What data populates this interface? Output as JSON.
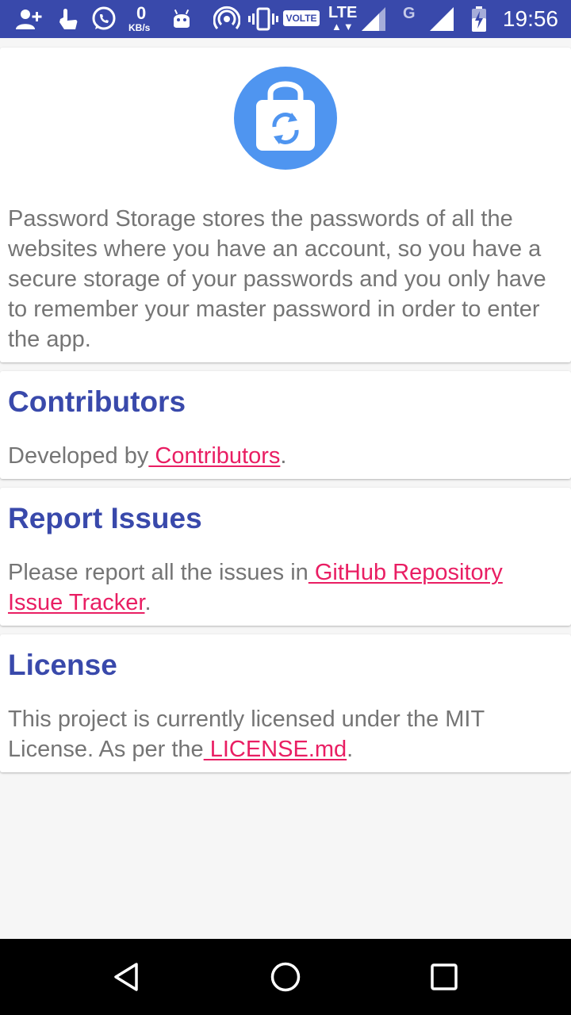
{
  "status_bar": {
    "time": "19:56",
    "net_speed_value": "0",
    "net_speed_unit": "KB/s",
    "volte_label": "VOLTE",
    "lte_label": "LTE",
    "g_label": "G",
    "icons": [
      "add-contact-icon",
      "touch-icon",
      "whatsapp-icon",
      "android-icon",
      "hotspot-icon",
      "vibrate-icon",
      "signal-icon",
      "signal-icon",
      "battery-icon"
    ],
    "background": "#3949ab"
  },
  "about": {
    "logo_icon": "lock-sync-icon",
    "description": "Password Storage stores the passwords of all the websites where you have an account, so you have a secure storage of your passwords and you only have to remember your master password in order to enter the app."
  },
  "contributors": {
    "title": "Contributors",
    "text_prefix": "Developed by",
    "link": " Contributors",
    "text_suffix": "."
  },
  "report_issues": {
    "title": "Report Issues",
    "text_prefix": "Please report all the issues in",
    "link": " GitHub Repository Issue Tracker",
    "text_suffix": "."
  },
  "license": {
    "title": "License",
    "text_prefix": "This project is currently licensed under the MIT License. As per the",
    "link": " LICENSE.md",
    "text_suffix": "."
  },
  "nav": {
    "back_icon": "back-icon",
    "home_icon": "home-icon",
    "recents_icon": "recents-icon"
  },
  "colors": {
    "accent_title": "#3949ab",
    "link": "#e91e63",
    "body_text": "#757575",
    "logo_bg": "#4f95f0"
  }
}
